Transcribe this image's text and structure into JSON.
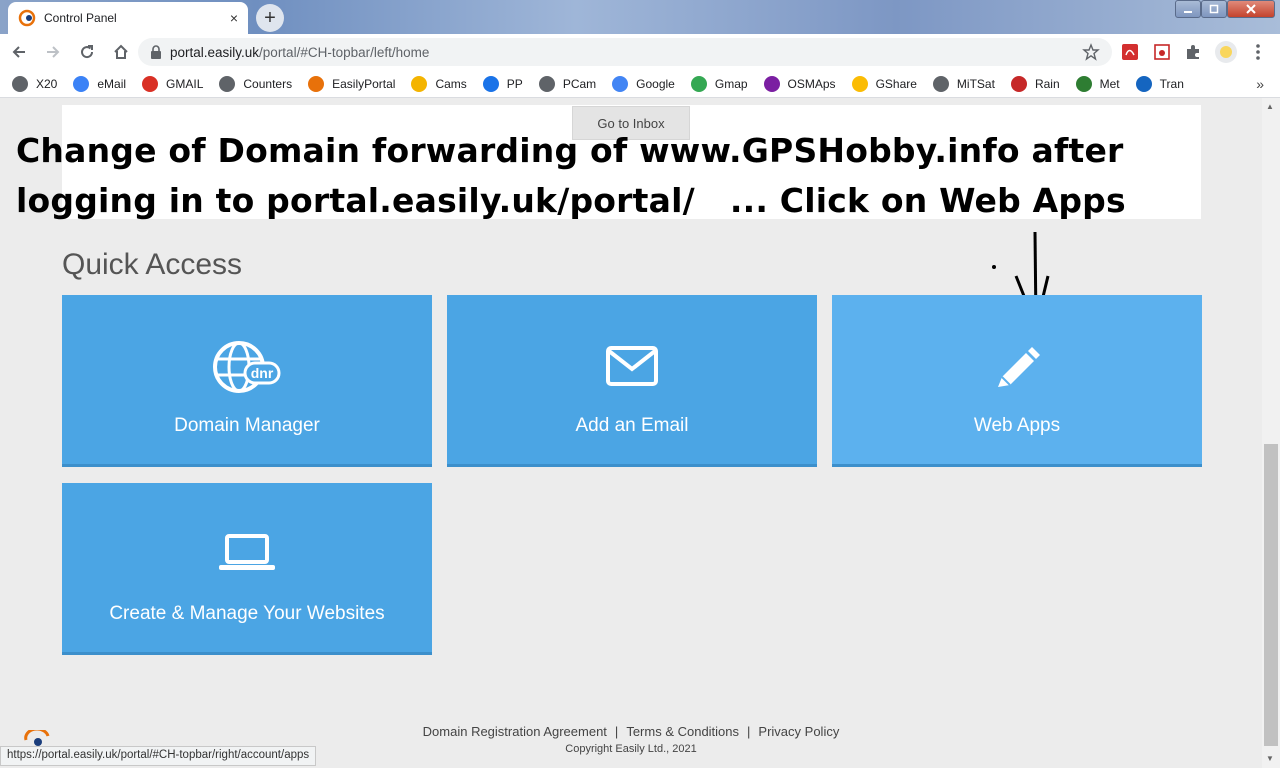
{
  "browser": {
    "tab_title": "Control Panel",
    "tab_close": "×",
    "new_tab": "+",
    "url_domain": "portal.easily.uk",
    "url_path": "/portal/#CH-topbar/left/home",
    "status_url": "https://portal.easily.uk/portal/#CH-topbar/right/account/apps"
  },
  "bookmarks": [
    {
      "label": "X20",
      "color": "#5f6368"
    },
    {
      "label": "eMail",
      "color": "#3b82f6"
    },
    {
      "label": "GMAIL",
      "color": "#d93025"
    },
    {
      "label": "Counters",
      "color": "#5f6368"
    },
    {
      "label": "EasilyPortal",
      "color": "#e8710a"
    },
    {
      "label": "Cams",
      "color": "#f4b400"
    },
    {
      "label": "PP",
      "color": "#1a73e8"
    },
    {
      "label": "PCam",
      "color": "#5f6368"
    },
    {
      "label": "Google",
      "color": "#4285f4"
    },
    {
      "label": "Gmap",
      "color": "#34a853"
    },
    {
      "label": "OSMAps",
      "color": "#7b1fa2"
    },
    {
      "label": "GShare",
      "color": "#fbbc04"
    },
    {
      "label": "MiTSat",
      "color": "#5f6368"
    },
    {
      "label": "Rain",
      "color": "#c62828"
    },
    {
      "label": "Met",
      "color": "#2e7d32"
    },
    {
      "label": "Tran",
      "color": "#1565c0"
    }
  ],
  "bookmarks_more": "»",
  "page": {
    "go_to_inbox": "Go to Inbox",
    "overlay_line1": "Change of Domain forwarding of www.GPSHobby.info after",
    "overlay_line2": "logging in to portal.easily.uk/portal/   ... Click on Web Apps",
    "quick_access_title": "Quick Access",
    "tiles": [
      {
        "label": "Domain Manager",
        "icon": "globe-dnr-icon"
      },
      {
        "label": "Add an Email",
        "icon": "envelope-icon"
      },
      {
        "label": "Web Apps",
        "icon": "pencil-icon"
      },
      {
        "label": "Create & Manage Your Websites",
        "icon": "laptop-icon"
      }
    ],
    "dnr_badge": "dnr"
  },
  "footer": {
    "links": [
      "Domain Registration Agreement",
      "Terms & Conditions",
      "Privacy Policy"
    ],
    "separator": "|",
    "copyright": "Copyright Easily Ltd., 2021"
  },
  "colors": {
    "tile": "#4ba5e4",
    "tile_highlight": "#5cb1ee"
  }
}
